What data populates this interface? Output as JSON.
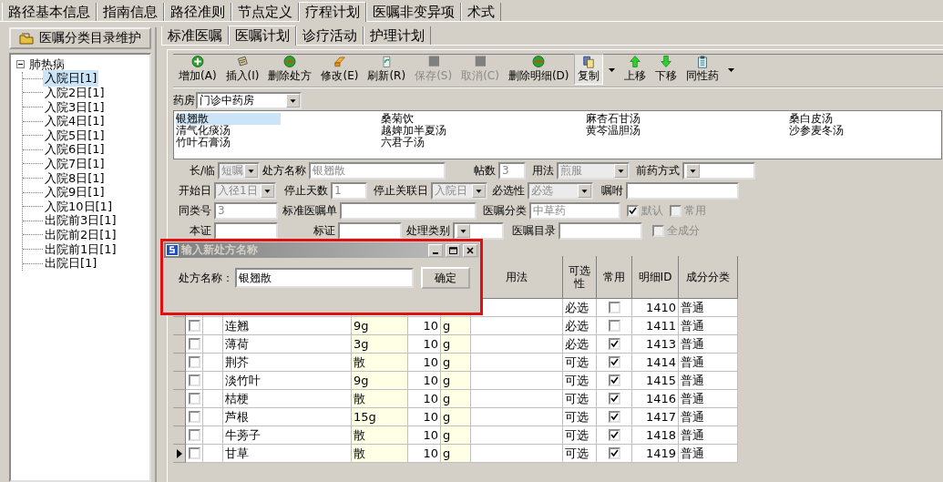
{
  "main_tabs": [
    {
      "label": "路径基本信息",
      "selected": false
    },
    {
      "label": "指南信息",
      "selected": false
    },
    {
      "label": "路径准则",
      "selected": false
    },
    {
      "label": "节点定义",
      "selected": false
    },
    {
      "label": "疗程计划",
      "selected": true
    },
    {
      "label": "医嘱非变异项",
      "selected": false
    },
    {
      "label": "术式",
      "selected": false
    }
  ],
  "sidebar": {
    "button": "医嘱分类目录维护",
    "tree": [
      {
        "label": "肺热病",
        "expanded": true,
        "selected": false,
        "children": [
          {
            "label": "入院日[1]",
            "selected": true
          },
          {
            "label": "入院2日[1]",
            "selected": false
          },
          {
            "label": "入院3日[1]",
            "selected": false
          },
          {
            "label": "入院4日[1]",
            "selected": false
          },
          {
            "label": "入院5日[1]",
            "selected": false
          },
          {
            "label": "入院6日[1]",
            "selected": false
          },
          {
            "label": "入院7日[1]",
            "selected": false
          },
          {
            "label": "入院8日[1]",
            "selected": false
          },
          {
            "label": "入院9日[1]",
            "selected": false
          },
          {
            "label": "入院10日[1]",
            "selected": false
          },
          {
            "label": "出院前3日[1]",
            "selected": false
          },
          {
            "label": "出院前2日[1]",
            "selected": false
          },
          {
            "label": "出院前1日[1]",
            "selected": false
          },
          {
            "label": "出院日[1]",
            "selected": false
          }
        ]
      }
    ]
  },
  "sub_tabs": [
    {
      "label": "标准医嘱",
      "selected": false
    },
    {
      "label": "医嘱计划",
      "selected": true
    },
    {
      "label": "诊疗活动",
      "selected": false
    },
    {
      "label": "护理计划",
      "selected": false
    }
  ],
  "toolbar": [
    {
      "label": "增加(A)",
      "kind": "add",
      "disabled": false
    },
    {
      "label": "插入(I)",
      "kind": "insert",
      "disabled": false
    },
    {
      "label": "删除处方",
      "kind": "remove",
      "disabled": false
    },
    {
      "label": "修改(E)",
      "kind": "edit",
      "disabled": false
    },
    {
      "label": "刷新(R)",
      "kind": "refresh",
      "disabled": false
    },
    {
      "label": "保存(S)",
      "kind": "save",
      "disabled": true
    },
    {
      "label": "取消(C)",
      "kind": "cancel",
      "disabled": true
    },
    {
      "label": "删除明细(D)",
      "kind": "remove",
      "disabled": false
    },
    {
      "label": "复制",
      "kind": "copy",
      "disabled": false,
      "dropdown": true
    },
    {
      "label": "上移",
      "kind": "up",
      "disabled": false
    },
    {
      "label": "下移",
      "kind": "down",
      "disabled": false
    },
    {
      "label": "同性药",
      "kind": "clipboard",
      "disabled": false,
      "dropdown": true
    }
  ],
  "pharmacy": {
    "label": "药房",
    "value": "门诊中药房"
  },
  "prescriptions": [
    {
      "label": "银翘散",
      "selected": true
    },
    {
      "label": "桑菊饮",
      "selected": false
    },
    {
      "label": "麻杏石甘汤",
      "selected": false
    },
    {
      "label": "桑白皮汤",
      "selected": false
    },
    {
      "label": "清气化痰汤",
      "selected": false
    },
    {
      "label": "越婢加半夏汤",
      "selected": false
    },
    {
      "label": "黄芩温胆汤",
      "selected": false
    },
    {
      "label": "沙参麦冬汤",
      "selected": false
    },
    {
      "label": "竹叶石膏汤",
      "selected": false
    },
    {
      "label": "六君子汤",
      "selected": false
    }
  ],
  "form": [
    [
      {
        "kind": "select",
        "label": "长/临",
        "value": "短嘱",
        "disabled": true
      },
      {
        "kind": "text",
        "label": "处方名称",
        "value": "银翘散",
        "disabled": true
      },
      {
        "kind": "text",
        "label": "帖数",
        "value": "3",
        "disabled": true
      },
      {
        "kind": "select",
        "label": "用法",
        "value": "煎服",
        "disabled": true
      },
      {
        "kind": "select",
        "label": "前药方式"
      }
    ],
    [
      {
        "kind": "select",
        "label": "开始日",
        "value": "入径1日",
        "disabled": true
      },
      {
        "kind": "text",
        "label": "停止天数",
        "value": "1",
        "disabled": true
      },
      {
        "kind": "select",
        "label": "停止关联日",
        "value": "入院日",
        "disabled": true
      },
      {
        "kind": "select",
        "label": "必选性",
        "value": "必选",
        "disabled": true
      },
      {
        "kind": "text",
        "label": "嘱咐"
      }
    ],
    [
      {
        "kind": "text",
        "label": "同类号",
        "value": "3",
        "disabled": true
      },
      {
        "kind": "text",
        "label": "标准医嘱单"
      },
      {
        "kind": "text",
        "label": "医嘱分类",
        "value": "中草药",
        "disabled": true
      },
      {
        "kind": "checkbox",
        "label": "默认",
        "checked": true,
        "disabled": true
      },
      {
        "kind": "checkbox",
        "label": "常用",
        "checked": false,
        "disabled": true
      }
    ],
    [
      {
        "kind": "text",
        "label": "本证"
      },
      {
        "kind": "text",
        "label": "标证"
      },
      {
        "kind": "select",
        "label": "处理类别"
      },
      {
        "kind": "text",
        "label": "医嘱目录"
      },
      {
        "kind": "checkbox",
        "label": "全成分",
        "checked": false,
        "disabled": true
      }
    ]
  ],
  "table": {
    "columns": [
      {
        "label": "用法"
      },
      {
        "label": "可选性"
      },
      {
        "label": "常用"
      },
      {
        "label": "明细ID"
      },
      {
        "label": "成分分类"
      }
    ],
    "rows": [
      {
        "optional": "必选",
        "common": false,
        "id": "1410",
        "category": "普通"
      },
      {
        "current": false,
        "checked": false,
        "name": "连翘",
        "dose": "9g",
        "qty": "10",
        "unit": "g",
        "optional": "必选",
        "common": false,
        "id": "1411",
        "category": "普通"
      },
      {
        "current": false,
        "checked": false,
        "name": "薄荷",
        "dose": "3g",
        "qty": "10",
        "unit": "g",
        "optional": "必选",
        "common": true,
        "id": "1413",
        "category": "普通"
      },
      {
        "current": false,
        "checked": false,
        "name": "荆芥",
        "dose": "散",
        "qty": "10",
        "unit": "g",
        "optional": "可选",
        "common": true,
        "id": "1414",
        "category": "普通"
      },
      {
        "current": false,
        "checked": false,
        "name": "淡竹叶",
        "dose": "9g",
        "qty": "10",
        "unit": "g",
        "optional": "可选",
        "common": true,
        "id": "1415",
        "category": "普通"
      },
      {
        "current": false,
        "checked": false,
        "name": "桔梗",
        "dose": "散",
        "qty": "10",
        "unit": "g",
        "optional": "可选",
        "common": true,
        "id": "1416",
        "category": "普通"
      },
      {
        "current": false,
        "checked": false,
        "name": "芦根",
        "dose": "15g",
        "qty": "10",
        "unit": "g",
        "optional": "可选",
        "common": true,
        "id": "1417",
        "category": "普通"
      },
      {
        "current": false,
        "checked": false,
        "name": "牛蒡子",
        "dose": "散",
        "qty": "10",
        "unit": "g",
        "optional": "可选",
        "common": true,
        "id": "1418",
        "category": "普通"
      },
      {
        "current": true,
        "checked": false,
        "name": "甘草",
        "dose": "散",
        "qty": "10",
        "unit": "g",
        "optional": "可选",
        "common": true,
        "id": "1419",
        "category": "普通"
      }
    ]
  },
  "dialog": {
    "title": "输入新处方名称",
    "label": "处方名称：",
    "value": "银翘散",
    "button": "确定"
  }
}
